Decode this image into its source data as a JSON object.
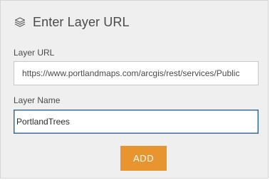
{
  "dialog": {
    "icon": "layers-icon",
    "title": "Enter Layer URL"
  },
  "url_field": {
    "label": "Layer URL",
    "value": "https://www.portlandmaps.com/arcgis/rest/services/Public"
  },
  "name_field": {
    "label": "Layer Name",
    "value": "PortlandTrees"
  },
  "actions": {
    "add_label": "ADD"
  },
  "colors": {
    "panel_background": "#efefef",
    "accent_button": "#e8952f",
    "focused_border": "#3a6c97"
  }
}
